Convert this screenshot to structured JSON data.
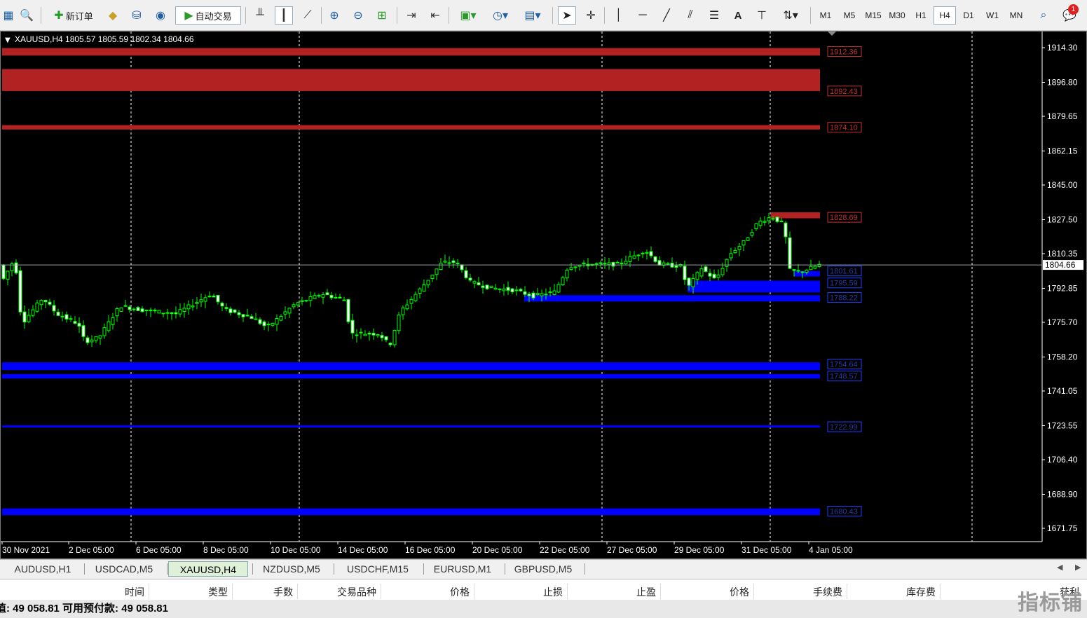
{
  "toolbar": {
    "new_order_label": "新订单",
    "auto_trade_label": "自动交易",
    "timeframes": [
      "M1",
      "M5",
      "M15",
      "M30",
      "H1",
      "H4",
      "D1",
      "W1",
      "MN"
    ],
    "active_timeframe": "H4",
    "alert_count": "1"
  },
  "chart": {
    "header": "XAUUSD,H4  1805.57 1805.59 1802.34 1804.66",
    "current_price": "1804.66",
    "price_axis": [
      "1914.30",
      "1896.80",
      "1879.65",
      "1862.15",
      "1845.00",
      "1827.50",
      "1810.35",
      "1792.85",
      "1775.70",
      "1758.20",
      "1741.05",
      "1723.55",
      "1706.40",
      "1688.90",
      "1671.75"
    ],
    "time_axis": [
      "30 Nov 2021",
      "2 Dec 05:00",
      "6 Dec 05:00",
      "8 Dec 05:00",
      "10 Dec 05:00",
      "14 Dec 05:00",
      "16 Dec 05:00",
      "20 Dec 05:00",
      "22 Dec 05:00",
      "27 Dec 05:00",
      "29 Dec 05:00",
      "31 Dec 05:00",
      "4 Jan 05:00"
    ],
    "resistance_levels": [
      "1912.36",
      "1892.43",
      "1874.10",
      "1828.69"
    ],
    "support_levels": [
      "1801.61",
      "1795.59",
      "1788.22",
      "1754.64",
      "1748.57",
      "1722.99",
      "1680.43"
    ],
    "colors": {
      "bull": "#00ff00",
      "resistance": "#b22222",
      "support": "#0000ff",
      "background": "#000000",
      "grid": "#ffffff"
    }
  },
  "tabs": [
    "AUDUSD,H1",
    "USDCAD,M5",
    "XAUUSD,H4",
    "NZDUSD,M5",
    "USDCHF,M15",
    "EURUSD,M1",
    "GBPUSD,M5"
  ],
  "active_tab": "XAUUSD,H4",
  "terminal": {
    "columns": [
      "时间",
      "类型",
      "手数",
      "交易品种",
      "价格",
      "止损",
      "止盈",
      "价格",
      "手续费",
      "库存费",
      "获利"
    ],
    "balance_row": "值: 49 058.81  可用预付款: 49 058.81",
    "watermark": "指标铺"
  }
}
